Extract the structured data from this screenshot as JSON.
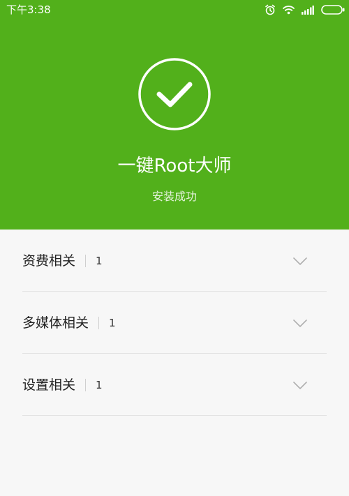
{
  "status_bar": {
    "time": "下午3:38",
    "icons": [
      "alarm-icon",
      "wifi-icon",
      "signal-icon",
      "battery-icon"
    ]
  },
  "header": {
    "icon": "checkmark-icon",
    "title": "一键Root大师",
    "subtitle": "安装成功",
    "background_color": "#52b01b"
  },
  "items": [
    {
      "label": "资费相关",
      "count": "1"
    },
    {
      "label": "多媒体相关",
      "count": "1"
    },
    {
      "label": "设置相关",
      "count": "1"
    }
  ]
}
